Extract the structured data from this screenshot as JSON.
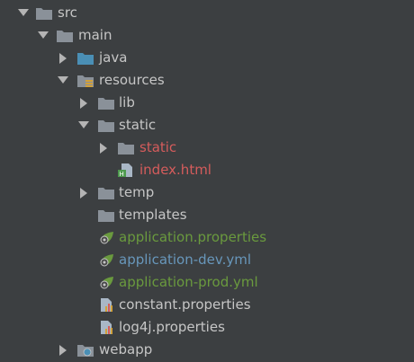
{
  "colors": {
    "background": "#3c3f41",
    "text": "#c6c6c6",
    "excluded_red": "#d55c5c",
    "modified_green": "#6a9a3e",
    "modified_blue": "#6897bb",
    "folder": "#8a9199",
    "source_folder": "#4a8fb5"
  },
  "tree": {
    "src": {
      "label": "src",
      "icon": "folder-icon"
    },
    "main": {
      "label": "main",
      "icon": "folder-icon"
    },
    "java": {
      "label": "java",
      "icon": "source-folder-icon"
    },
    "resources": {
      "label": "resources",
      "icon": "resources-folder-icon"
    },
    "lib": {
      "label": "lib",
      "icon": "folder-icon"
    },
    "static": {
      "label": "static",
      "icon": "folder-icon"
    },
    "static_inner": {
      "label": "static",
      "icon": "folder-icon"
    },
    "index_html": {
      "label": "index.html",
      "icon": "html-file-icon"
    },
    "temp": {
      "label": "temp",
      "icon": "folder-icon"
    },
    "templates": {
      "label": "templates",
      "icon": "folder-icon"
    },
    "application_properties": {
      "label": "application.properties",
      "icon": "spring-config-icon"
    },
    "application_dev": {
      "label": "application-dev.yml",
      "icon": "spring-config-icon"
    },
    "application_prod": {
      "label": "application-prod.yml",
      "icon": "spring-config-icon"
    },
    "constant_properties": {
      "label": "constant.properties",
      "icon": "properties-file-icon"
    },
    "log4j_properties": {
      "label": "log4j.properties",
      "icon": "properties-file-icon"
    },
    "webapp": {
      "label": "webapp",
      "icon": "web-folder-icon"
    }
  }
}
